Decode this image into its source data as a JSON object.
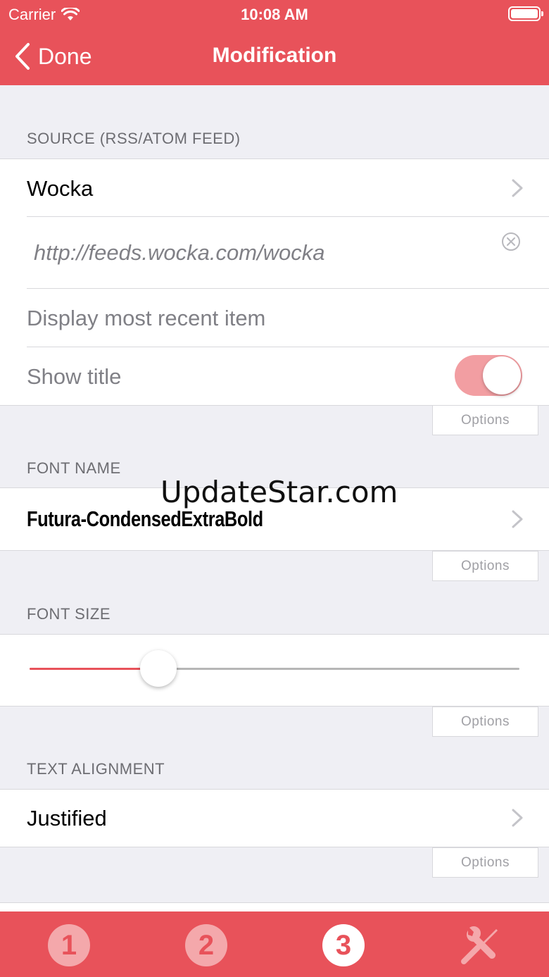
{
  "status_bar": {
    "carrier": "Carrier",
    "time": "10:08 AM"
  },
  "nav": {
    "back_label": "Done",
    "title": "Modification"
  },
  "source_section": {
    "header": "SOURCE (RSS/ATOM FEED)",
    "feed_name": "Wocka",
    "feed_url": "http://feeds.wocka.com/wocka",
    "display_mode": "Display most recent item",
    "show_title_label": "Show title",
    "show_title_on": true,
    "options_label": "Options"
  },
  "font_name_section": {
    "header": "FONT NAME",
    "font_name": "Futura-CondensedExtraBold",
    "options_label": "Options"
  },
  "font_size_section": {
    "header": "FONT SIZE",
    "slider_value_fraction": 0.263,
    "options_label": "Options"
  },
  "text_alignment_section": {
    "header": "TEXT ALIGNMENT",
    "alignment": "Justified",
    "options_label": "Options"
  },
  "watermark": "UpdateStar.com",
  "tabs": [
    {
      "label": "1",
      "active": false
    },
    {
      "label": "2",
      "active": false
    },
    {
      "label": "3",
      "active": true
    },
    {
      "label": "tools",
      "active": false
    }
  ],
  "colors": {
    "accent": "#e8525a",
    "toggle_on": "#f29ea2",
    "background": "#efeff4"
  }
}
